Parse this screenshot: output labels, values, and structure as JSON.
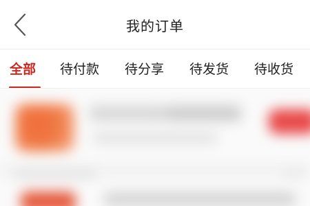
{
  "header": {
    "title": "我的订单",
    "back_icon": "chevron-left-icon"
  },
  "tabs": [
    {
      "label": "全部",
      "active": true
    },
    {
      "label": "待付款",
      "active": false
    },
    {
      "label": "待分享",
      "active": false
    },
    {
      "label": "待发货",
      "active": false
    },
    {
      "label": "待收货",
      "active": false
    }
  ],
  "colors": {
    "accent": "#c8281f",
    "title_text": "#222222",
    "background": "#ffffff"
  }
}
